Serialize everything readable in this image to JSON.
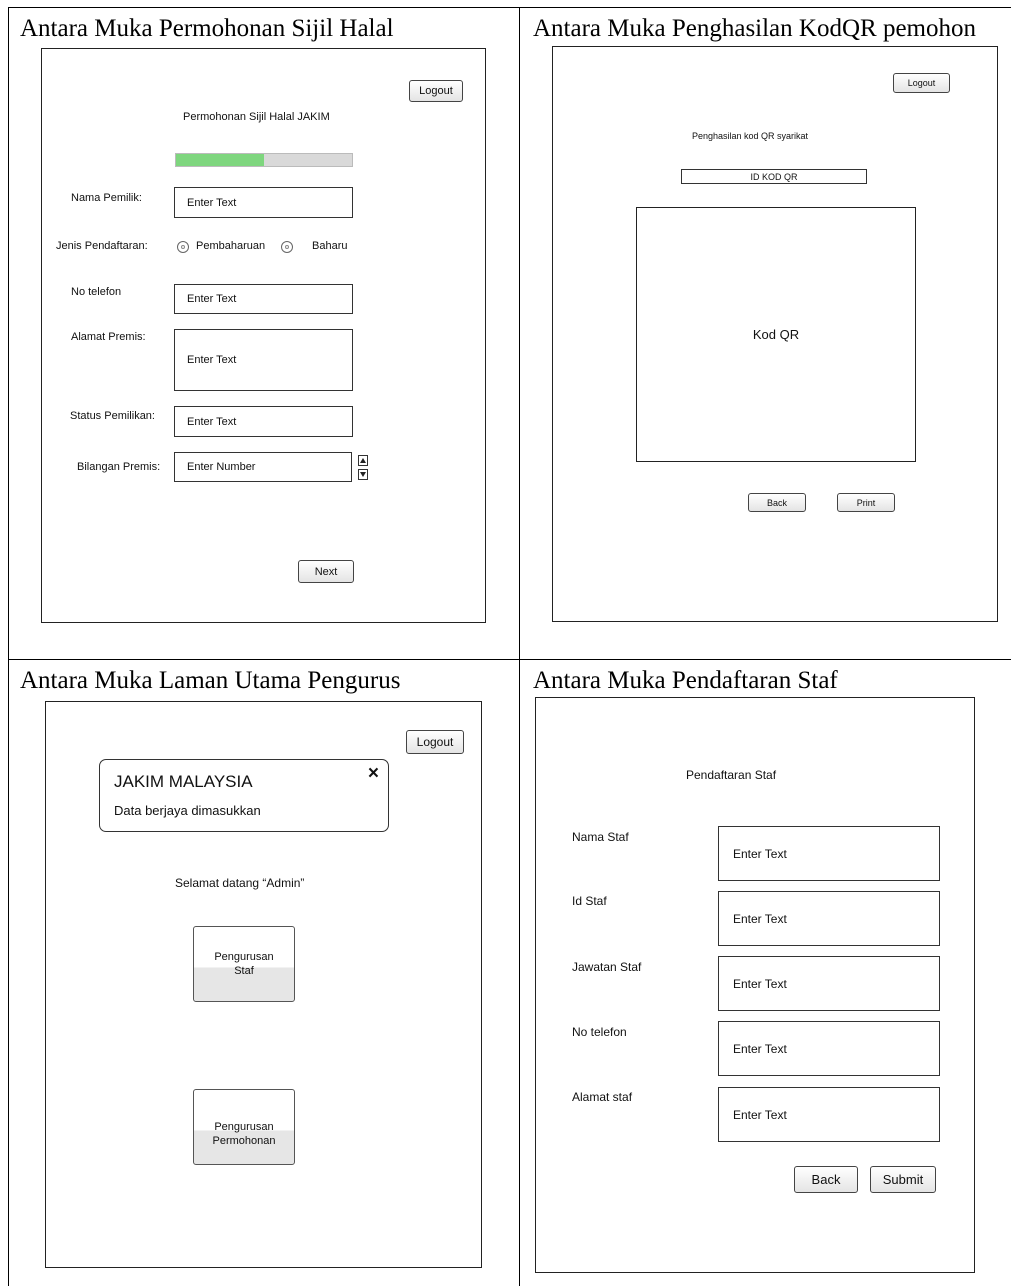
{
  "cells": {
    "top_left_title": "Antara Muka Permohonan Sijil Halal",
    "top_right_title": "Antara Muka Penghasilan KodQR pemohon",
    "bottom_left_title": "Antara Muka Laman Utama Pengurus",
    "bottom_right_title": "Antara Muka Pendaftaran Staf"
  },
  "permohonan": {
    "logout": "Logout",
    "heading": "Permohonan Sijil Halal JAKIM",
    "progress": 0.5,
    "nama_label": "Nama Pemilik:",
    "nama_placeholder": "Enter Text",
    "jenis_label": "Jenis Pendaftaran:",
    "option_pembaharuan": "Pembaharuan",
    "option_baharu": "Baharu",
    "telefon_label": "No telefon",
    "telefon_placeholder": "Enter Text",
    "alamat_label": "Alamat Premis:",
    "alamat_placeholder": "Enter Text",
    "status_label": "Status Pemilikan:",
    "status_placeholder": "Enter Text",
    "bilangan_label": "Bilangan Premis:",
    "bilangan_placeholder": "Enter Number",
    "next": "Next"
  },
  "kodqr": {
    "logout": "Logout",
    "heading": "Penghasilan kod QR syarikat",
    "id_field": "ID KOD QR",
    "qr_label": "Kod QR",
    "back": "Back",
    "print": "Print"
  },
  "pengurus": {
    "logout": "Logout",
    "alert_title": "JAKIM MALAYSIA",
    "alert_message": "Data berjaya dimasukkan",
    "alert_close": "×",
    "welcome": "Selamat datang “Admin”",
    "btn_staf": "Pengurusan\nStaf",
    "btn_permohonan": "Pengurusan\nPermohonan"
  },
  "staf": {
    "heading": "Pendaftaran Staf",
    "nama_label": "Nama Staf",
    "nama_placeholder": "Enter Text",
    "id_label": "Id Staf",
    "id_placeholder": "Enter Text",
    "jawatan_label": "Jawatan Staf",
    "jawatan_placeholder": "Enter Text",
    "telefon_label": "No telefon",
    "telefon_placeholder": "Enter Text",
    "alamat_label": "Alamat staf",
    "alamat_placeholder": "Enter Text",
    "back": "Back",
    "submit": "Submit"
  },
  "colors": {
    "progress_fill": "#7ed67e",
    "progress_track": "#d9d9d9"
  }
}
